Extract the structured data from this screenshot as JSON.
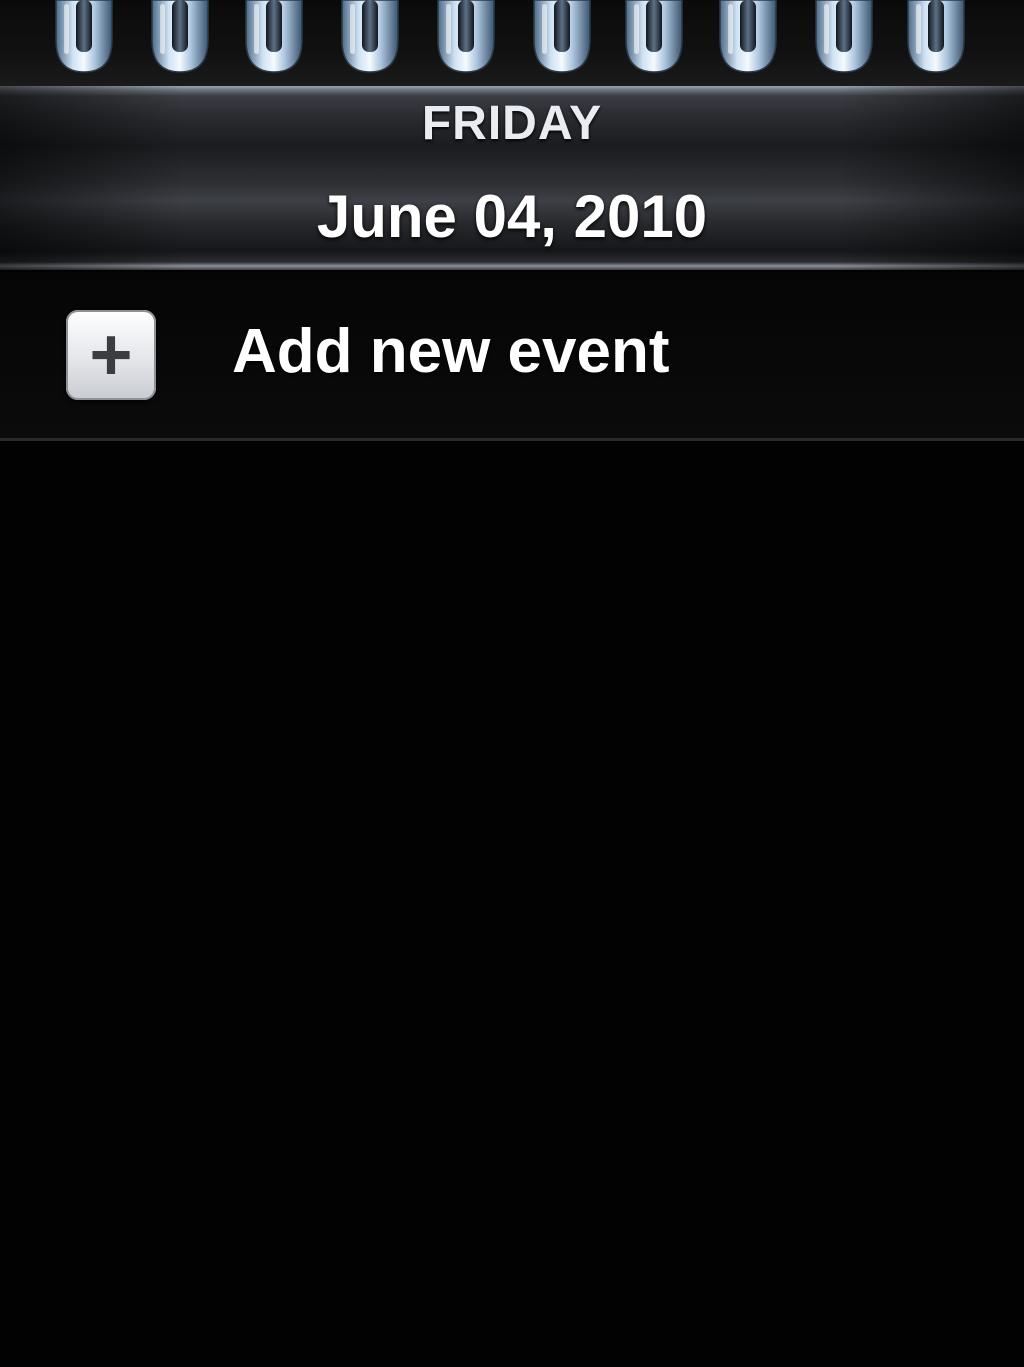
{
  "header": {
    "day": "FRIDAY",
    "date": "June 04, 2010"
  },
  "add_event": {
    "icon": "plus-icon",
    "label": "Add new event"
  },
  "colors": {
    "background": "#020202",
    "ring_metal": "#b9d0e6",
    "text": "#ffffff"
  }
}
